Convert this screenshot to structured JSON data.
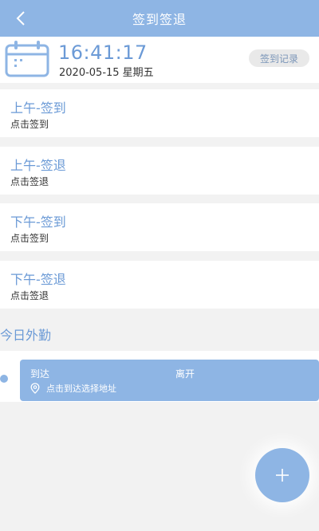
{
  "header": {
    "title": "签到签退"
  },
  "clock": {
    "time": "16:41:17",
    "date": "2020-05-15 星期五",
    "records_label": "签到记录"
  },
  "cards": [
    {
      "title": "上午-签到",
      "subtitle": "点击签到"
    },
    {
      "title": "上午-签退",
      "subtitle": "点击签退"
    },
    {
      "title": "下午-签到",
      "subtitle": "点击签到"
    },
    {
      "title": "下午-签退",
      "subtitle": "点击签退"
    }
  ],
  "field_work": {
    "section_title": "今日外勤",
    "arrive_label": "到达",
    "leave_label": "离开",
    "location_prompt": "点击到达选择地址"
  },
  "colors": {
    "accent": "#8eb5e4",
    "accent_text": "#6b9ad6",
    "background": "#f2f2f2"
  },
  "icons": {
    "back": "chevron-left-icon",
    "calendar": "calendar-icon",
    "location": "location-pin-icon",
    "add": "plus-icon"
  }
}
